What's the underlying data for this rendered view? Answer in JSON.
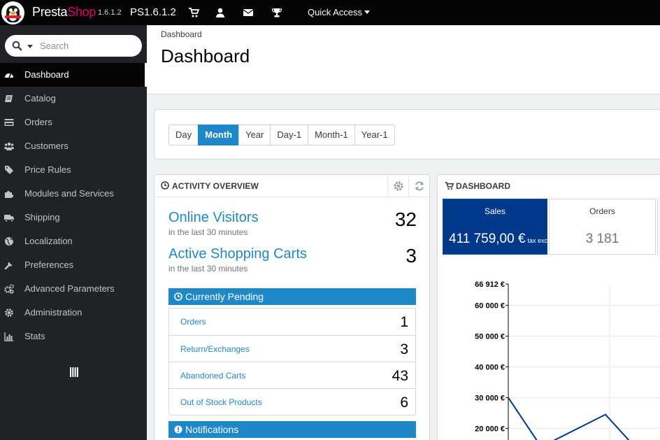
{
  "topbar": {
    "brand_part1": "Presta",
    "brand_part2": "Shop",
    "version": "1.6.1.2",
    "shop_name": "PS1.6.1.2",
    "quick_access": "Quick Access",
    "icons": [
      "cart-icon",
      "user-icon",
      "envelope-icon",
      "trophy-icon"
    ]
  },
  "search": {
    "placeholder": "Search"
  },
  "sidebar": {
    "items": [
      {
        "label": "Dashboard",
        "icon": "dashboard-icon",
        "active": true
      },
      {
        "label": "Catalog",
        "icon": "book-icon"
      },
      {
        "label": "Orders",
        "icon": "credit-card-icon"
      },
      {
        "label": "Customers",
        "icon": "users-icon"
      },
      {
        "label": "Price Rules",
        "icon": "tags-icon"
      },
      {
        "label": "Modules and Services",
        "icon": "puzzle-icon"
      },
      {
        "label": "Shipping",
        "icon": "truck-icon"
      },
      {
        "label": "Localization",
        "icon": "globe-icon"
      },
      {
        "label": "Preferences",
        "icon": "wrench-icon"
      },
      {
        "label": "Advanced Parameters",
        "icon": "cogs-icon"
      },
      {
        "label": "Administration",
        "icon": "cog-icon"
      },
      {
        "label": "Stats",
        "icon": "bar-chart-icon"
      }
    ]
  },
  "page": {
    "breadcrumb": "Dashboard",
    "title": "Dashboard"
  },
  "periods": {
    "buttons": [
      "Day",
      "Month",
      "Year",
      "Day-1",
      "Month-1",
      "Year-1"
    ],
    "active": "Month"
  },
  "activity": {
    "title": "ACTIVITY OVERVIEW",
    "visitors": {
      "label": "Online Visitors",
      "sub": "in the last 30 minutes",
      "value": "32"
    },
    "carts": {
      "label": "Active Shopping Carts",
      "sub": "in the last 30 minutes",
      "value": "3"
    },
    "pending_title": "Currently Pending",
    "pending": [
      {
        "label": "Orders",
        "value": "1"
      },
      {
        "label": "Return/Exchanges",
        "value": "3"
      },
      {
        "label": "Abandoned Carts",
        "value": "43"
      },
      {
        "label": "Out of Stock Products",
        "value": "6"
      }
    ],
    "notifications_title": "Notifications"
  },
  "dashboard": {
    "title": "DASHBOARD",
    "sales": {
      "label": "Sales",
      "value": "411 759,00 €",
      "suffix": "tax exc"
    },
    "orders": {
      "label": "Orders",
      "value": "3 181"
    }
  },
  "chart_data": {
    "type": "line",
    "y_ticks": [
      "66 912 €",
      "60 000 €",
      "50 000 €",
      "40 000 €",
      "30 000 €",
      "20 000 €"
    ],
    "y_values": [
      66912,
      60000,
      50000,
      40000,
      30000,
      20000
    ],
    "ylim": [
      16000,
      66912
    ],
    "series": [
      {
        "values": [
          30000,
          14000,
          24500,
          14000
        ],
        "color": "#00388b"
      }
    ]
  }
}
